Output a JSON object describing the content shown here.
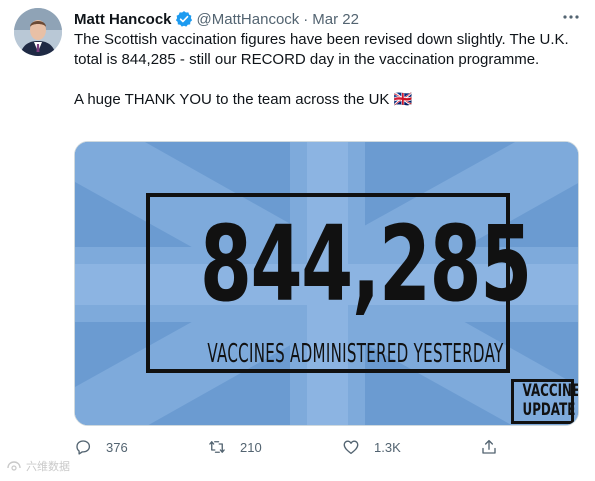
{
  "tweet": {
    "author_name": "Matt Hancock",
    "handle": "@MattHancock",
    "separator": "·",
    "date": "Mar 22",
    "text": "The Scottish vaccination figures have been revised down slightly. The U.K. total is 844,285 - still our RECORD day in the vaccination programme.\n\nA huge THANK YOU to the team across the UK 🇬🇧"
  },
  "media": {
    "big_number": "844,285",
    "subtitle": "VACCINES ADMINISTERED YESTERDAY",
    "badge_line1": "VACCINE",
    "badge_line2": "UPDATE",
    "background_color": "#6b9bd1"
  },
  "actions": {
    "reply_count": "376",
    "retweet_count": "210",
    "like_count": "1.3K"
  },
  "watermark": "六维数据",
  "colors": {
    "verified": "#1d9bf0",
    "secondary_text": "#536471"
  }
}
